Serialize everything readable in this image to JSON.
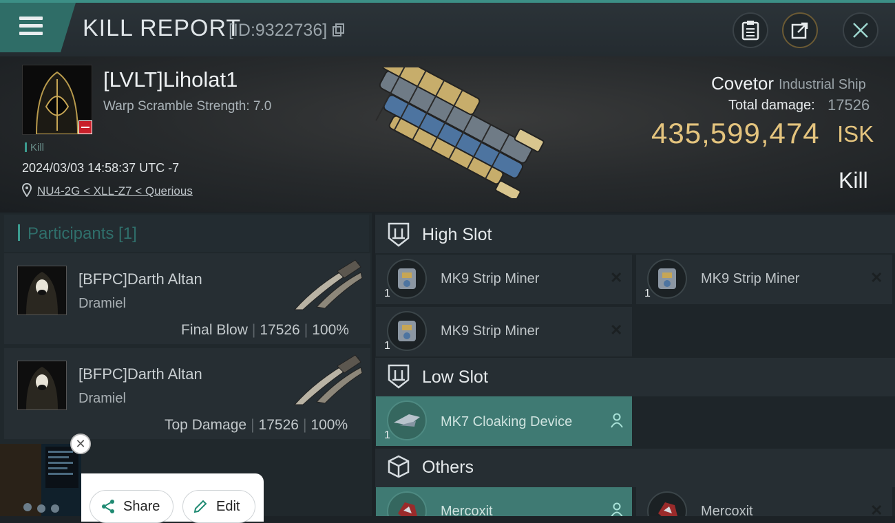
{
  "header": {
    "title": "KILL REPORT",
    "report_id": "[ID:9322736]"
  },
  "victim": {
    "name": "[LVLT]Liholat1",
    "warp_scramble": "Warp Scramble Strength: 7.0",
    "kill_tag": "Kill",
    "datetime": "2024/03/03 14:58:37 UTC -7",
    "location": "NU4-2G < XLL-Z7 < Querious"
  },
  "ship": {
    "name": "Covetor",
    "class": "Industrial Ship",
    "total_damage_label": "Total damage:",
    "total_damage": "17526",
    "isk_value": "435,599,474",
    "isk_unit": "ISK",
    "result": "Kill"
  },
  "participants": {
    "title": "Participants [1]",
    "rows": [
      {
        "name": "[BFPC]Darth Altan",
        "ship": "Dramiel",
        "role": "Final Blow",
        "damage": "17526",
        "percent": "100%"
      },
      {
        "name": "[BFPC]Darth Altan",
        "ship": "Dramiel",
        "role": "Top Damage",
        "damage": "17526",
        "percent": "100%"
      }
    ]
  },
  "slots": {
    "high": {
      "title": "High Slot",
      "items": [
        {
          "name": "MK9 Strip Miner",
          "qty": "1"
        },
        {
          "name": "MK9 Strip Miner",
          "qty": "1"
        },
        {
          "name": "MK9 Strip Miner",
          "qty": "1"
        }
      ]
    },
    "low": {
      "title": "Low Slot",
      "items": [
        {
          "name": "MK7 Cloaking Device",
          "qty": "1"
        }
      ]
    },
    "others": {
      "title": "Others",
      "items": [
        {
          "name": "Mercoxit"
        },
        {
          "name": "Mercoxit"
        }
      ]
    }
  },
  "popup": {
    "share_label": "Share",
    "edit_label": "Edit"
  },
  "colors": {
    "accent_teal": "#3c8f86",
    "isk_gold": "#e4c47e",
    "active_card": "#3f7a73"
  }
}
